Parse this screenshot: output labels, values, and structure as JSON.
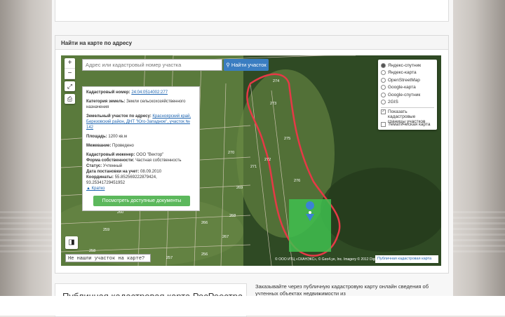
{
  "panel": {
    "title": "Найти на карте по адресу"
  },
  "search": {
    "placeholder": "Адрес или кадастровый номер участка",
    "button": "Найти участок"
  },
  "zoom": {
    "in": "+",
    "out": "−"
  },
  "layers": {
    "options": [
      "Яндекс-спутник",
      "Яндекс-карта",
      "OpenStreetMap",
      "Google-карта",
      "Google-спутник",
      "2GIS"
    ],
    "selected": "Яндекс-спутник",
    "show_cadastral": "Показать кадастровые границы участков",
    "thematic": "Тематическая карта"
  },
  "info": {
    "cad_label": "Кадастровый номер:",
    "cad_value": "24:04:0514002:277",
    "cat_label": "Категория земель:",
    "cat_value": "Земли сельскохозяйственного назначения",
    "addr_label": "Земельный участок по адресу:",
    "addr_value": "Красноярский край, Березовский район, ДНТ \"Юго-Западное\", участок № 142",
    "area_label": "Площадь:",
    "area_value": "1200 кв.м",
    "survey_label": "Межевание:",
    "survey_value": "Проведено",
    "eng_label": "Кадастровый инженер:",
    "eng_value": "ООО \"Вектор\"",
    "own_label": "Форма собственности:",
    "own_value": "Частная собственность",
    "status_label": "Статус:",
    "status_value": "Учтенный",
    "date_label": "Дата постановки на учет:",
    "date_value": "08.09.2010",
    "coords_label": "Координаты:",
    "coords_value": "55.852569222879424, 93.25341729451952",
    "brief": "▲ Кратко",
    "docs_button": "Посмотреть доступные документы"
  },
  "help_text": "Не нашли участок на карте?",
  "copyright": "© ООО ИТЦ «СКАНЭКС», © Geo4.ye, Inc. Imagery © 2012 DigitalGlobe",
  "public_map_link": "Публичная кадастровая карта",
  "map_labels": [
    "274",
    "273",
    "275",
    "276",
    "272",
    "271",
    "270",
    "269",
    "268",
    "267",
    "266",
    "265",
    "264",
    "263",
    "262",
    "261",
    "260",
    "259",
    "258",
    "257",
    "256"
  ],
  "bottom": {
    "title": "Публичная кадастровая карта РосРеестра",
    "text": "Заказывайте через публичную кадастровую карту онлайн сведения об учтенных объектах недвижимости из"
  }
}
